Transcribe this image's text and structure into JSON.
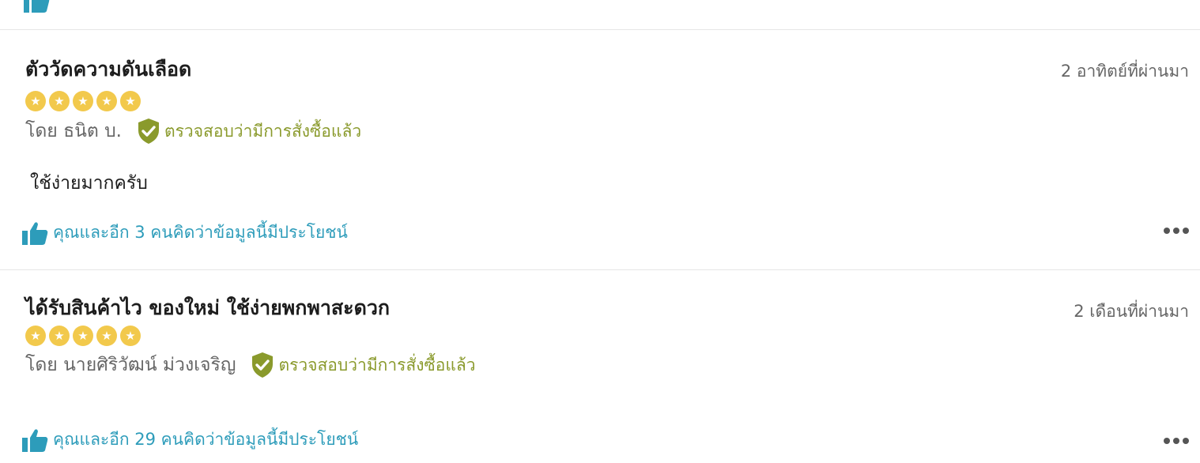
{
  "colors": {
    "star": "#f2c94c",
    "verified": "#8a9a2c",
    "helpful_link": "#2d9cba",
    "divider": "#e6e6e6"
  },
  "reviews": [
    {
      "title": "ตัววัดความดันเลือด",
      "date": "2 อาทิตย์ที่ผ่านมา",
      "rating": 5,
      "author": "โดย ธนิต บ.",
      "verified_label": "ตรวจสอบว่ามีการสั่งซื้อแล้ว",
      "body": "ใช้ง่ายมากครับ",
      "helpful_text": "คุณและอีก 3 คนคิดว่าข้อมูลนี้มีประโยชน์"
    },
    {
      "title": "ได้รับสินค้าไว ของใหม่ ใช้ง่ายพกพาสะดวก",
      "date": "2 เดือนที่ผ่านมา",
      "rating": 5,
      "author": "โดย นายศิริวัฒน์ ม่วงเจริญ",
      "verified_label": "ตรวจสอบว่ามีการสั่งซื้อแล้ว",
      "body": "",
      "helpful_text": "คุณและอีก 29 คนคิดว่าข้อมูลนี้มีประโยชน์"
    }
  ],
  "icons": {
    "like": "thumbs-up-icon",
    "verified": "shield-check-icon",
    "star": "star-icon",
    "more": "more-dots-icon"
  }
}
